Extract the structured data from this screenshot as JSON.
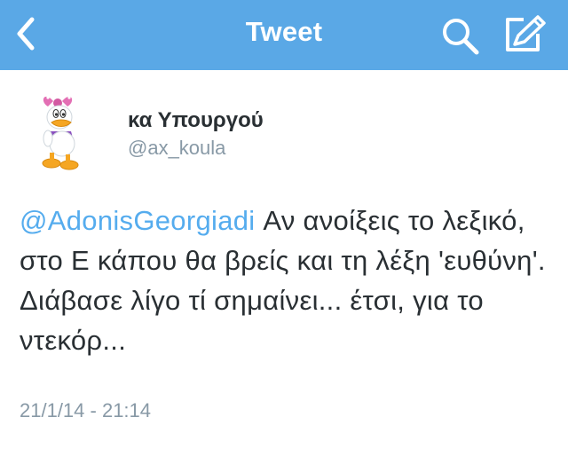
{
  "nav": {
    "title": "Tweet",
    "bg_color": "#5aa8e6",
    "back_icon": "chevron-left-icon",
    "search_icon": "search-icon",
    "compose_icon": "compose-icon"
  },
  "tweet": {
    "display_name": "κα Υπουργού",
    "username": "@ax_koula",
    "mention": "@AdonisGeorgiadi",
    "text": " Αν ανοίξεις το λεξικό, στο Ε κάπου θα βρείς και τη λέξη 'ευθύνη'. Διάβασε λίγο τί σημαίνει... έτσι, για το ντεκόρ...",
    "timestamp": "21/1/14 - 21:14",
    "mention_color": "#55acee"
  }
}
